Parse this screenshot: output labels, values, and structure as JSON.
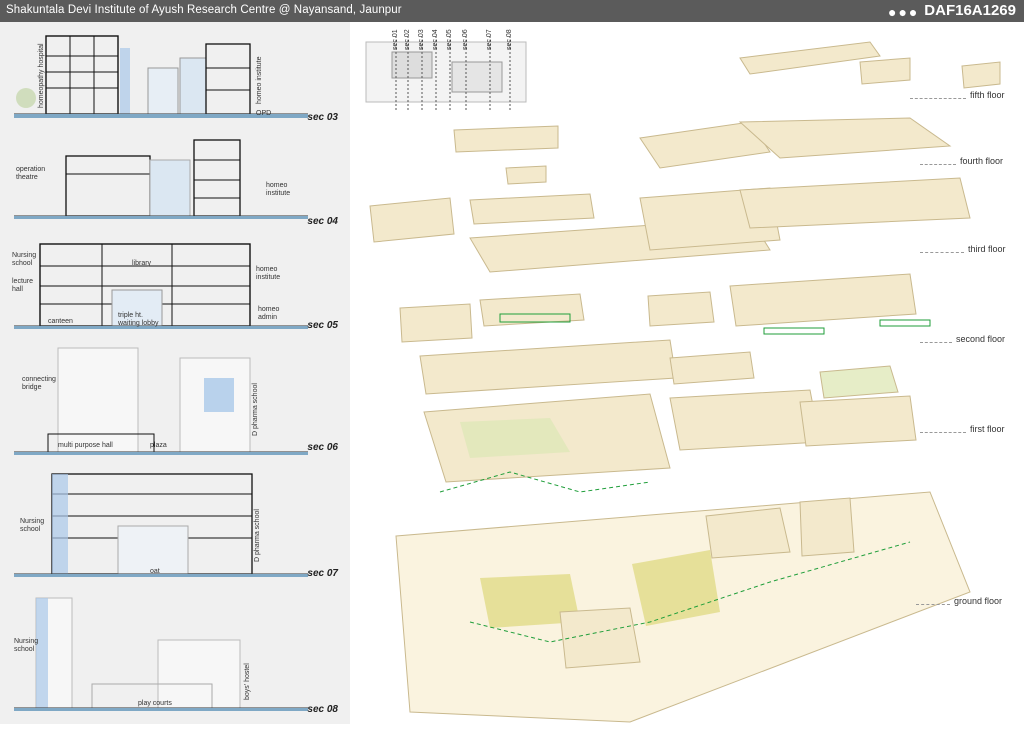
{
  "header": {
    "title": "Shakuntala Devi Institute of Ayush Research Centre @ Nayansand, Jaunpur",
    "dots": "●●●",
    "code": "DAF16A1269"
  },
  "sections": [
    {
      "name": "sec 03",
      "labels": [
        "homeopathy hospital",
        "homeo institute",
        "OPD"
      ]
    },
    {
      "name": "sec 04",
      "labels": [
        "operation theatre",
        "homeo institute"
      ]
    },
    {
      "name": "sec 05",
      "labels": [
        "Nursing school",
        "library",
        "homeo institute",
        "lecture hall",
        "homeo admin",
        "canteen",
        "triple ht. waiting lobby"
      ]
    },
    {
      "name": "sec 06",
      "labels": [
        "connecting bridge",
        "D pharma school",
        "multi purpose hall",
        "plaza"
      ]
    },
    {
      "name": "sec 07",
      "labels": [
        "Nursing school",
        "D pharma school",
        "oat"
      ]
    },
    {
      "name": "sec 08",
      "labels": [
        "Nursing school",
        "boys' hostel",
        "play courts"
      ]
    }
  ],
  "key_plan": {
    "section_marks": [
      "sec 01",
      "sec 02",
      "sec 03",
      "sec 04",
      "sec 05",
      "sec 06",
      "sec 07",
      "sec 08"
    ]
  },
  "floors": [
    "fifth floor",
    "fourth floor",
    "third floor",
    "second floor",
    "first floor",
    "ground floor"
  ],
  "colors": {
    "header_bg": "#5b5b5b",
    "panel_bg": "#f0f0f0",
    "mass": "#f3e9cc",
    "mass_edge": "#c9b98e",
    "green": "#1f9e3a",
    "glass": "#a9c8e8",
    "landscape": "#d8d36a"
  }
}
